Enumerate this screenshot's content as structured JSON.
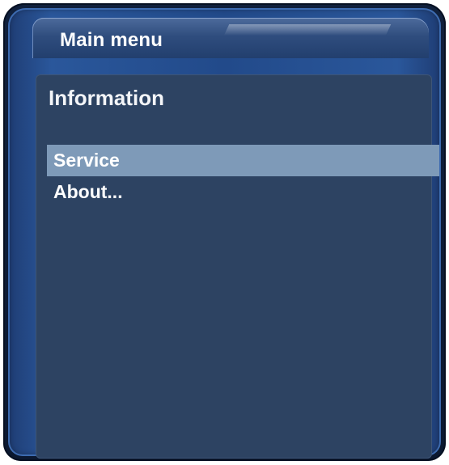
{
  "window": {
    "title": "Main menu"
  },
  "section": {
    "title": "Information"
  },
  "menu": {
    "items": [
      {
        "label": "Service",
        "selected": true
      },
      {
        "label": "About...",
        "selected": false
      }
    ]
  },
  "colors": {
    "frame": "#224a8a",
    "panel": "#2d4362",
    "selection": "#7e9ab8",
    "text": "#ffffff"
  }
}
